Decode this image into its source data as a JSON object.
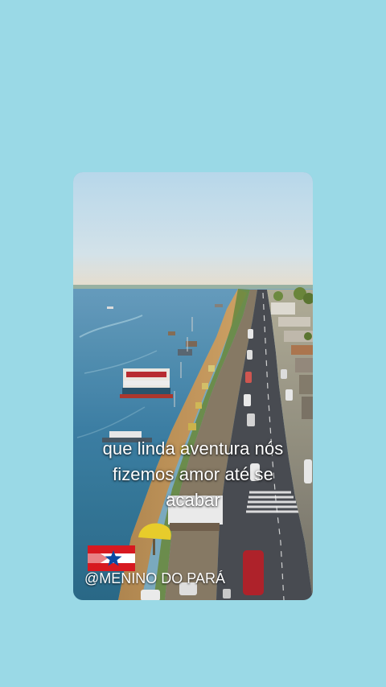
{
  "post": {
    "caption_lines": [
      "que linda aventura nós",
      "fizemos amor até se",
      "acabar"
    ],
    "handle": "@MENINO DO PARÁ"
  },
  "colors": {
    "background": "#9ad9e6",
    "sky": "#dcebf2",
    "river": "#4c8fb0",
    "beach": "#c99a5b",
    "road": "#4b4f55",
    "text": "#ffffff"
  },
  "icons": {
    "flag": "para-state-flag",
    "photo": "aerial-riverside-photo"
  }
}
